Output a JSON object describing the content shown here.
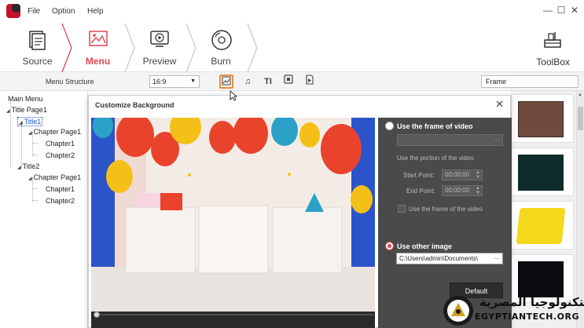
{
  "menubar": {
    "items": [
      "File",
      "Option",
      "Help"
    ]
  },
  "steps": [
    {
      "label": "Source"
    },
    {
      "label": "Menu"
    },
    {
      "label": "Preview"
    },
    {
      "label": "Burn"
    }
  ],
  "toolbox": {
    "label": "ToolBox"
  },
  "subbar": {
    "menu_structure": "Menu Structure",
    "aspect_ratio": "16:9",
    "frame_label": "Frame"
  },
  "tree": {
    "root": "Main Menu",
    "title_page": "Title Page1",
    "title1": "Title1",
    "chapter_page_a": "Chapter Page1",
    "chapter1_a": "Chapter1",
    "chapter2_a": "Chapter2",
    "title2": "Title2",
    "chapter_page_b": "Chapter Page1",
    "chapter1_b": "Chapter1",
    "chapter2_b": "Chapter2"
  },
  "dialog": {
    "title": "Customize Background",
    "use_frame_video": "Use the frame of video",
    "use_portion": "Use the portion of the video",
    "start_point_label": "Start Point:",
    "start_point_value": "00:00:00",
    "end_point_label": "End Point:",
    "end_point_value": "00:00:00",
    "use_frame_checkbox": "Use the frame of the video",
    "use_other_image": "Use other image",
    "image_path": "C:\\Users\\admin\\Documents\\",
    "browse_dots": "···",
    "default_button": "Default"
  },
  "watermark": {
    "arabic": "التكنولوجيا المصرية",
    "english": "EGYPTIANTECH.ORG"
  },
  "colors": {
    "accent": "#e0454f",
    "highlight": "#f08a3c",
    "panel_dark": "#4a4a4a"
  }
}
